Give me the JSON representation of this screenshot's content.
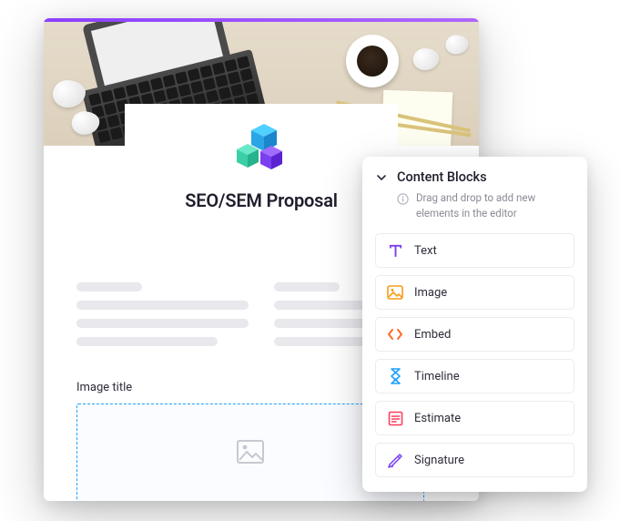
{
  "document": {
    "title": "SEO/SEM Proposal",
    "image_block_label": "Image title"
  },
  "panel": {
    "title": "Content Blocks",
    "hint": "Drag and drop to add new elements in the editor",
    "blocks": [
      {
        "label": "Text",
        "icon": "text-icon",
        "color": "#7b3ff2"
      },
      {
        "label": "Image",
        "icon": "image-icon",
        "color": "#f59d1a"
      },
      {
        "label": "Embed",
        "icon": "embed-icon",
        "color": "#ff6a2b"
      },
      {
        "label": "Timeline",
        "icon": "timeline-icon",
        "color": "#1ea0ff"
      },
      {
        "label": "Estimate",
        "icon": "estimate-icon",
        "color": "#ff3b5c"
      },
      {
        "label": "Signature",
        "icon": "signature-icon",
        "color": "#7b3ff2"
      }
    ]
  },
  "colors": {
    "accent": "#8b3fff",
    "dropzone_border": "#1ea0ff"
  }
}
